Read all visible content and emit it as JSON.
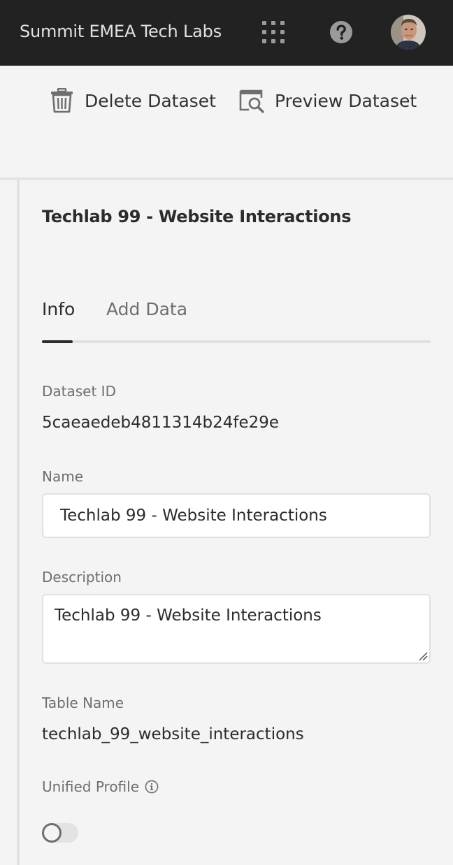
{
  "header": {
    "org_name": "Summit EMEA Tech Labs",
    "apps_icon": "apps-grid-icon",
    "help_icon": "help-circle-icon",
    "avatar": "user-avatar"
  },
  "actions": {
    "delete_label": "Delete Dataset",
    "delete_icon": "trash-icon",
    "preview_label": "Preview Dataset",
    "preview_icon": "preview-magnifier-icon"
  },
  "panel": {
    "title": "Techlab 99 - Website Interactions",
    "tabs": [
      {
        "label": "Info",
        "active": true
      },
      {
        "label": "Add Data",
        "active": false
      }
    ],
    "dataset_id": {
      "label": "Dataset ID",
      "value": "5caeaedeb4811314b24fe29e"
    },
    "name": {
      "label": "Name",
      "value": "Techlab 99 - Website Interactions"
    },
    "description": {
      "label": "Description",
      "value": "Techlab 99 - Website Interactions"
    },
    "table_name": {
      "label": "Table Name",
      "value": "techlab_99_website_interactions"
    },
    "unified_profile": {
      "label": "Unified Profile",
      "info_icon": "info-circle-icon",
      "enabled": false
    }
  },
  "colors": {
    "topbar_bg": "#222222",
    "page_bg": "#f4f4f4",
    "text_primary": "#2c2c2c",
    "text_secondary": "#6e6e6e",
    "divider": "#e1e1e1"
  }
}
